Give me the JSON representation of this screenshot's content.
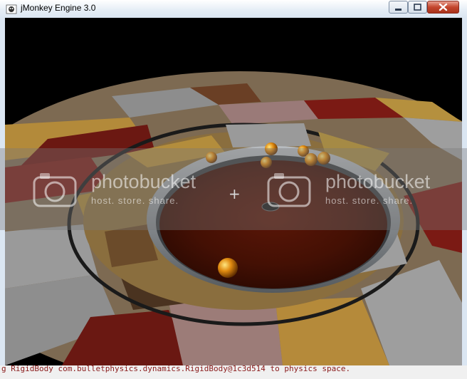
{
  "window": {
    "title": "jMonkey Engine 3.0",
    "icon": "jmonkey-app-icon",
    "controls": {
      "minimize": "minimize-icon",
      "maximize": "maximize-icon",
      "close": "close-icon"
    }
  },
  "scene": {
    "description_icons": [
      "crosshair-icon"
    ],
    "crosshair": "+",
    "colors": {
      "background": "#000000",
      "table_wood": "#4a1208",
      "rim": "#7a7e82"
    }
  },
  "watermark": {
    "brand": "photobucket",
    "tagline": "host. store. share."
  },
  "console": {
    "log_line": "g RigidBody com.bulletphysics.dynamics.RigidBody@1c3d514 to physics space."
  }
}
